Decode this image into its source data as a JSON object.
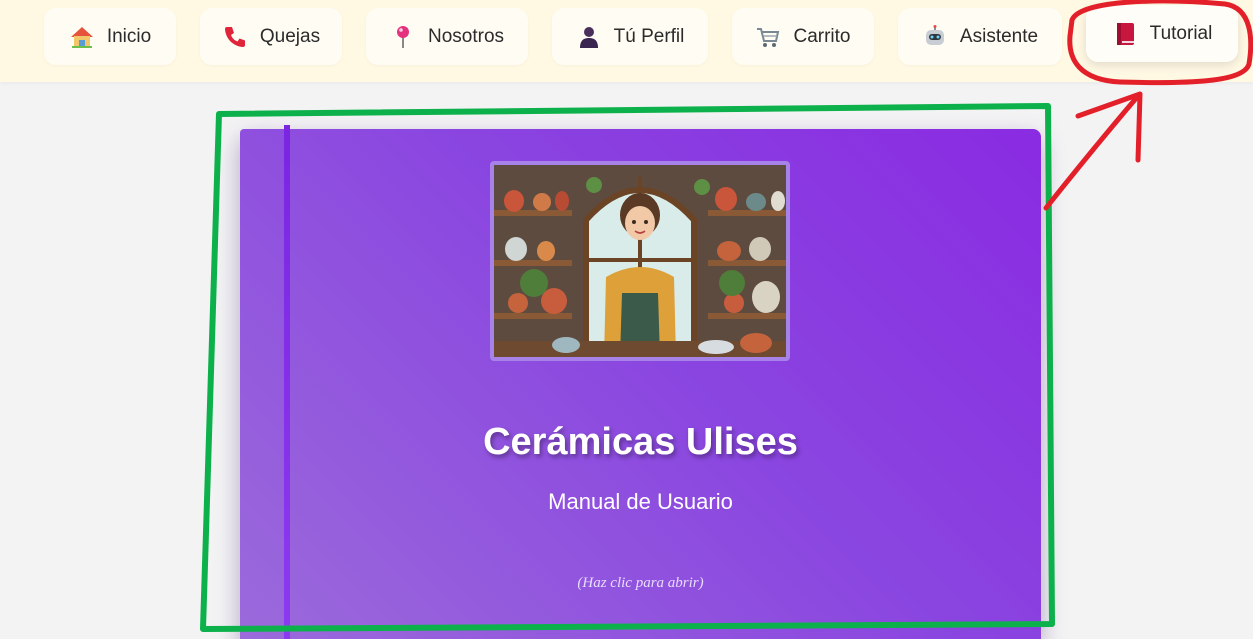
{
  "nav": {
    "items": [
      {
        "label": "Inicio",
        "icon": "house-icon"
      },
      {
        "label": "Quejas",
        "icon": "phone-icon"
      },
      {
        "label": "Nosotros",
        "icon": "pin-icon"
      },
      {
        "label": "Tú Perfil",
        "icon": "user-icon"
      },
      {
        "label": "Carrito",
        "icon": "cart-icon"
      },
      {
        "label": "Asistente",
        "icon": "robot-icon"
      },
      {
        "label": "Tutorial",
        "icon": "book-icon",
        "active": true
      }
    ]
  },
  "book": {
    "title": "Cerámicas Ulises",
    "subtitle": "Manual de Usuario",
    "hint": "(Haz clic para abrir)",
    "image_alt": "ceramics-shop-illustration"
  },
  "annotations": {
    "highlight_box_color": "#0db14b",
    "tutorial_circle_color": "#e3202a",
    "arrow_color": "#e3202a"
  }
}
